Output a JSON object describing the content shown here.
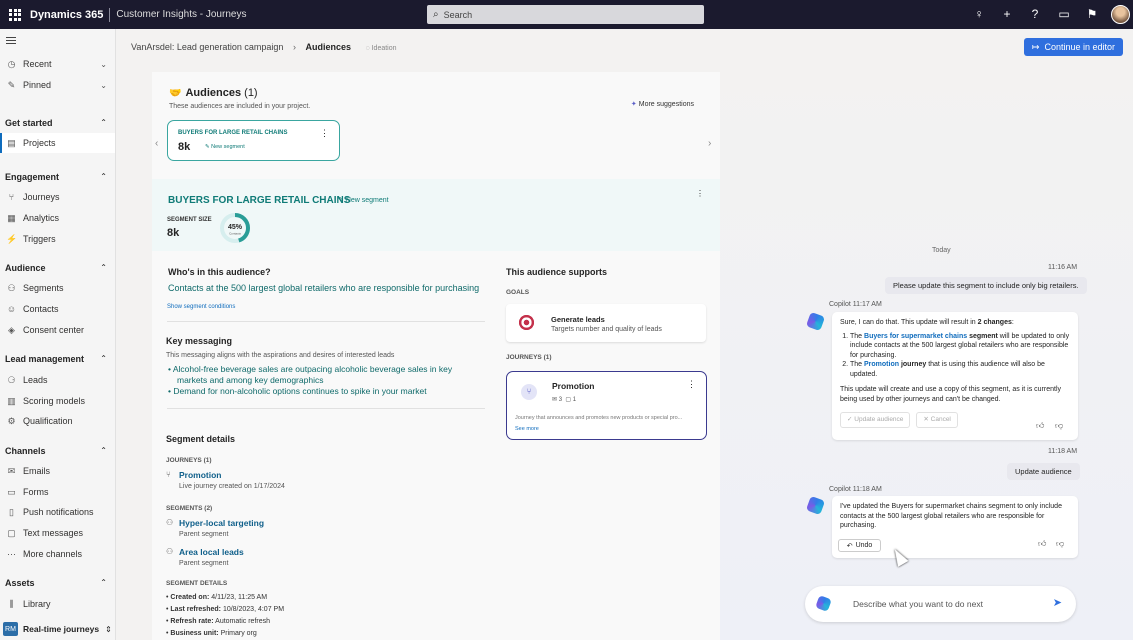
{
  "topbar": {
    "brand": "Dynamics 365",
    "app": "Customer Insights - Journeys",
    "search_placeholder": "Search"
  },
  "nav": {
    "recent": "Recent",
    "pinned": "Pinned",
    "get_started": "Get started",
    "projects": "Projects",
    "engagement": "Engagement",
    "journeys": "Journeys",
    "analytics": "Analytics",
    "triggers": "Triggers",
    "audience": "Audience",
    "segments": "Segments",
    "contacts": "Contacts",
    "consent": "Consent center",
    "lead_mgmt": "Lead management",
    "leads": "Leads",
    "scoring": "Scoring models",
    "qualification": "Qualification",
    "channels": "Channels",
    "emails": "Emails",
    "forms": "Forms",
    "push": "Push notifications",
    "text": "Text messages",
    "more": "More channels",
    "assets": "Assets",
    "library": "Library",
    "area_badge": "RM",
    "area": "Real-time journeys"
  },
  "breadcrumb": {
    "parent": "VanArsdel: Lead generation campaign",
    "current": "Audiences",
    "status": "Ideation"
  },
  "continue_btn": "Continue in editor",
  "audiences": {
    "title": "Audiences",
    "count": "(1)",
    "subtitle": "These audiences are included in your project.",
    "more_suggestions": "More suggestions",
    "card": {
      "title": "BUYERS FOR LARGE RETAIL CHAINS",
      "size": "8k",
      "badge": "New segment"
    }
  },
  "segment": {
    "title": "BUYERS FOR LARGE RETAIL CHAINS",
    "badge": "New segment",
    "size_label": "SEGMENT SIZE",
    "size": "8k",
    "donut_pct": "45%",
    "donut_sub": "Contacts",
    "donut_value": 0.45,
    "who_title": "Who's in this audience?",
    "who_desc": "Contacts at the 500 largest global retailers who are responsible for purchasing",
    "show_conditions": "Show segment conditions"
  },
  "messaging": {
    "title": "Key messaging",
    "desc": "This messaging aligns with the aspirations and desires of interested leads",
    "b1a": "Alcohol-free beverage sales are outpacing alcoholic beverage sales in key",
    "b1b": "markets and among key demographics",
    "b2": "Demand for non-alcoholic options continues to spike in your market"
  },
  "details": {
    "title": "Segment details",
    "journeys_cap": "JOURNEYS (1)",
    "journey_name": "Promotion",
    "journey_sub": "Live journey created on 1/17/2024",
    "segments_cap": "SEGMENTS (2)",
    "seg1": "Hyper-local targeting",
    "seg1_sub": "Parent segment",
    "seg2": "Area local leads",
    "seg2_sub": "Parent segment",
    "sd_cap": "SEGMENT DETAILS",
    "created_k": "Created on:",
    "created_v": "4/11/23, 11:25 AM",
    "refreshed_k": "Last refreshed:",
    "refreshed_v": "10/8/2023, 4:07 PM",
    "rate_k": "Refresh rate:",
    "rate_v": "Automatic refresh",
    "unit_k": "Business unit:",
    "unit_v": "Primary org"
  },
  "supports": {
    "title": "This audience supports",
    "goals_cap": "GOALS",
    "goal_title": "Generate leads",
    "goal_desc": "Targets number and quality of leads",
    "journeys_cap": "JOURNEYS (1)",
    "journey_title": "Promotion",
    "emails": "3",
    "comments": "1",
    "journey_desc": "Journey that announces and promotes new products or special pro...",
    "see_more": "See more"
  },
  "chat": {
    "today": "Today",
    "t1": "11:16 AM",
    "u1": "Please update this segment to include only big retailers.",
    "cp1_label": "Copilot   11:17 AM",
    "cp1_intro_a": "Sure, I can do that. This update will result in ",
    "cp1_intro_b": "2 changes",
    "cp1_i1_a": "The ",
    "cp1_i1_link": "Buyers for supermarket chains",
    "cp1_i1_b": " segment",
    "cp1_i1_c": " will be updated to only include contacts at the 500 largest global retailers who are responsible for purchasing.",
    "cp1_i2_a": "The ",
    "cp1_i2_link": "Promotion",
    "cp1_i2_b": " journey",
    "cp1_i2_c": " that is using this audience will also be updated.",
    "cp1_outro": "This update will create and use a copy of this segment, as it is currently being used by other journeys and can't be changed.",
    "btn_update": "Update audience",
    "btn_cancel": "Cancel",
    "t2": "11:18 AM",
    "u2": "Update audience",
    "cp2_label": "Copilot   11:18 AM",
    "cp2_text": "I've updated the Buyers for supermarket chains segment to only include contacts at the 500 largest global retailers who are responsible for purchasing.",
    "undo": "Undo",
    "input_placeholder": "Describe what you want to do next"
  },
  "colors": {
    "accent": "#2f6fde",
    "teal": "#0f7b77",
    "topbar": "#1b1a2e"
  }
}
